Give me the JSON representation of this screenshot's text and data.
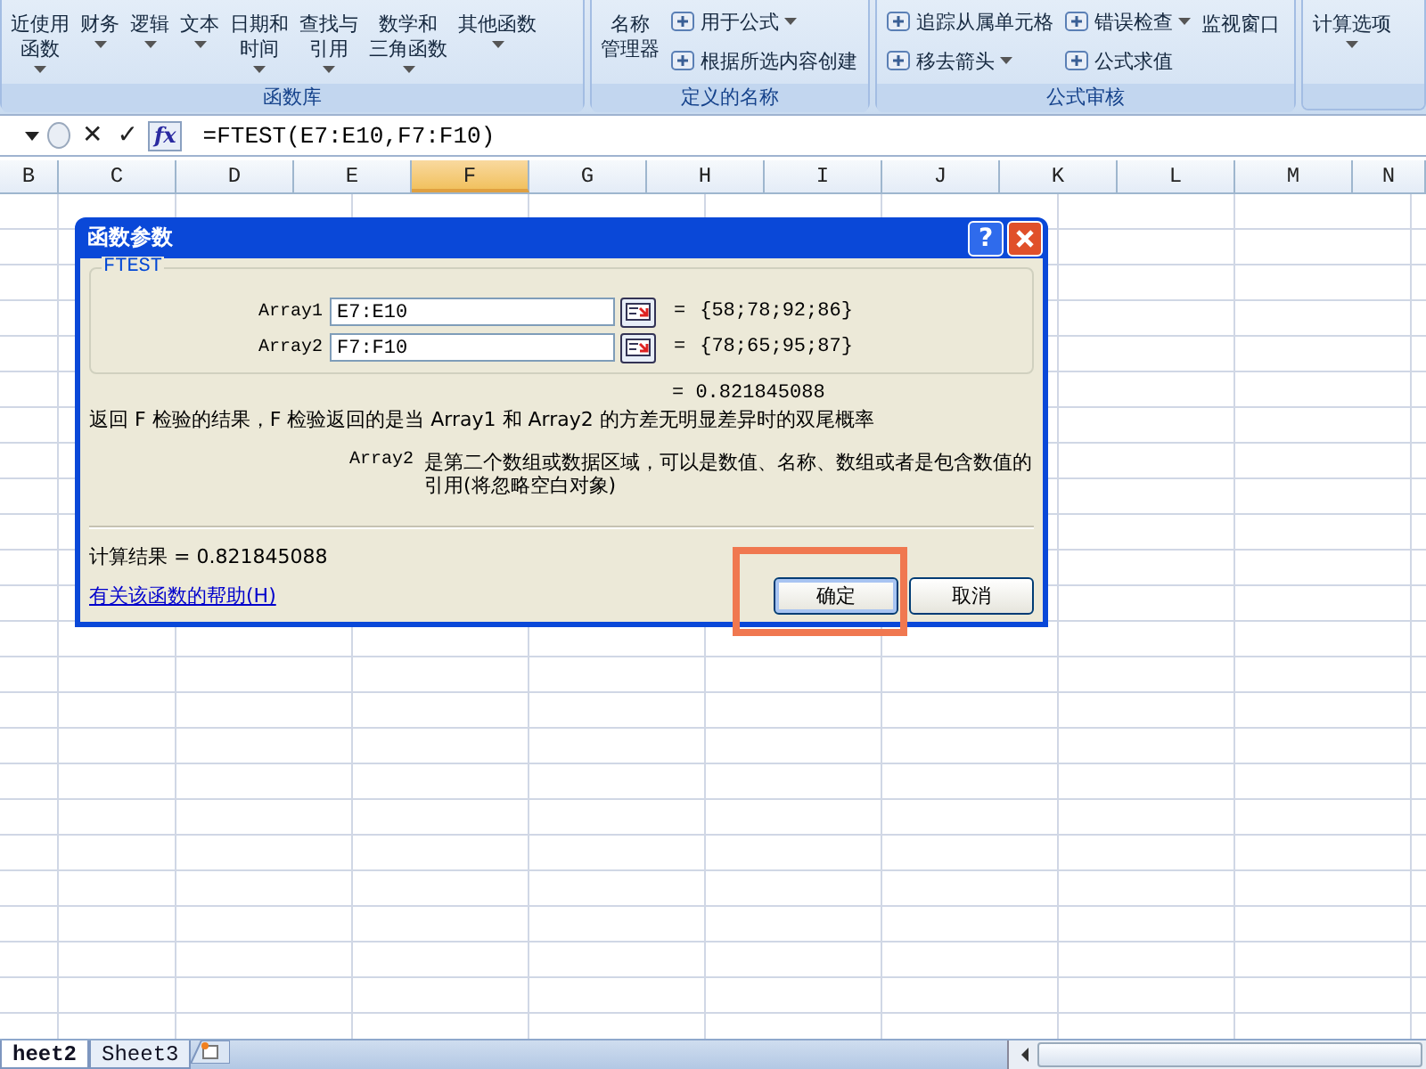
{
  "ribbon": {
    "groups": [
      {
        "label": "函数库",
        "items": [
          {
            "kind": "large",
            "lines": [
              "近使用",
              "函数"
            ],
            "dropdown": true
          },
          {
            "kind": "large",
            "lines": [
              "财务"
            ],
            "dropdown": true
          },
          {
            "kind": "large",
            "lines": [
              "逻辑"
            ],
            "dropdown": true
          },
          {
            "kind": "large",
            "lines": [
              "文本"
            ],
            "dropdown": true
          },
          {
            "kind": "large",
            "lines": [
              "日期和",
              "时间"
            ],
            "dropdown": true
          },
          {
            "kind": "large",
            "lines": [
              "查找与",
              "引用"
            ],
            "dropdown": true
          },
          {
            "kind": "large",
            "lines": [
              "数学和",
              "三角函数"
            ],
            "dropdown": true
          },
          {
            "kind": "large",
            "lines": [
              "其他函数"
            ],
            "dropdown": true
          }
        ]
      },
      {
        "label": "定义的名称",
        "items": [
          {
            "kind": "large",
            "lines": [
              "名称",
              "管理器"
            ],
            "dropdown": false
          },
          {
            "kind": "small",
            "lines": [
              "用于公式"
            ],
            "dropdown": true
          },
          {
            "kind": "small",
            "lines": [
              "根据所选内容创建"
            ],
            "dropdown": false
          }
        ]
      },
      {
        "label": "公式审核",
        "items": [
          {
            "kind": "small",
            "lines": [
              "追踪从属单元格"
            ],
            "dropdown": false
          },
          {
            "kind": "small",
            "lines": [
              "移去箭头"
            ],
            "dropdown": true
          },
          {
            "kind": "small",
            "lines": [
              "错误检查"
            ],
            "dropdown": true
          },
          {
            "kind": "small",
            "lines": [
              "公式求值"
            ],
            "dropdown": false
          },
          {
            "kind": "large",
            "lines": [
              "监视窗口"
            ],
            "dropdown": false
          }
        ]
      },
      {
        "items": [
          {
            "kind": "large",
            "lines": [
              "计算选项"
            ],
            "dropdown": true
          }
        ]
      }
    ]
  },
  "formula_bar": {
    "cancel": "✕",
    "enter": "✓",
    "function_button": "fx",
    "formula": "=FTEST(E7:E10,F7:F10)"
  },
  "columns": [
    {
      "label": "B",
      "selected": false
    },
    {
      "label": "C",
      "selected": false
    },
    {
      "label": "D",
      "selected": false
    },
    {
      "label": "E",
      "selected": false
    },
    {
      "label": "F",
      "selected": true
    },
    {
      "label": "G",
      "selected": false
    },
    {
      "label": "H",
      "selected": false
    },
    {
      "label": "I",
      "selected": false
    },
    {
      "label": "J",
      "selected": false
    },
    {
      "label": "K",
      "selected": false
    },
    {
      "label": "L",
      "selected": false
    },
    {
      "label": "M",
      "selected": false
    },
    {
      "label": "N",
      "selected": false
    }
  ],
  "sheet_tabs": [
    {
      "label": "heet2",
      "selected": true
    },
    {
      "label": "Sheet3",
      "selected": false
    }
  ],
  "dialog": {
    "title": "函数参数",
    "help_button": "?",
    "function_name": "FTEST",
    "arguments": [
      {
        "label": "Array1",
        "value": "E7:E10",
        "equals": "=",
        "result": "{58;78;92;86}"
      },
      {
        "label": "Array2",
        "value": "F7:F10",
        "equals": "=",
        "result": "{78;65;95;87}"
      }
    ],
    "formula_result": "= 0.821845088",
    "description": "返回 F 检验的结果，F 检验返回的是当 Array1 和 Array2 的方差无明显差异时的双尾概率",
    "argument_help": {
      "name": "Array2",
      "text": "是第二个数组或数据区域，可以是数值、名称、数组或者是包含数值的引用(将忽略空白对象)"
    },
    "calculation_result": "计算结果 = 0.821845088",
    "help_link": "有关该函数的帮助(H)",
    "buttons": [
      {
        "label": "确定",
        "default": true,
        "annotated": true
      },
      {
        "label": "取消",
        "default": false,
        "annotated": false
      }
    ]
  }
}
